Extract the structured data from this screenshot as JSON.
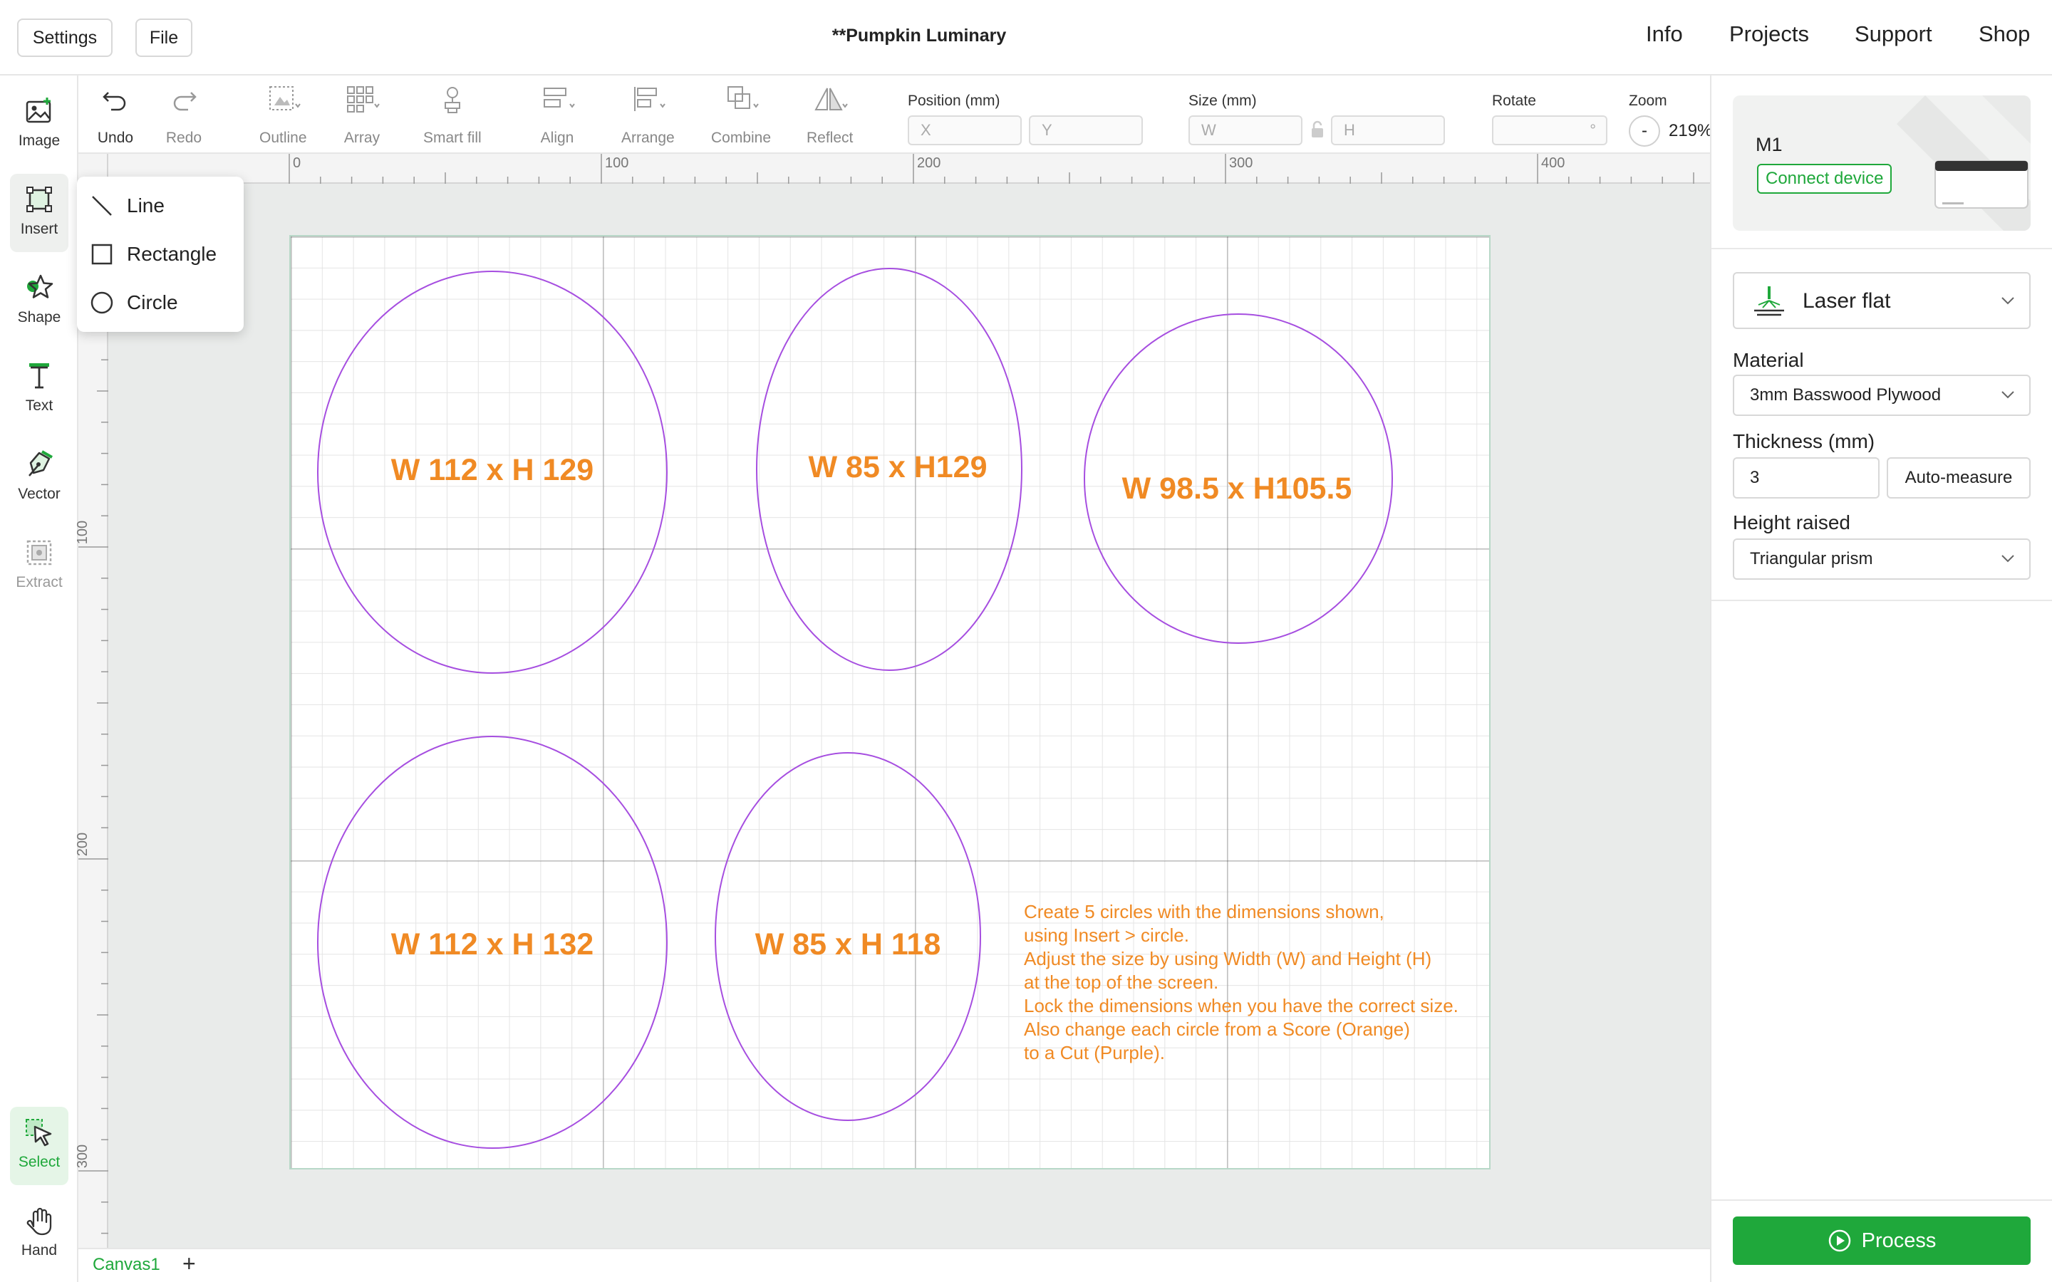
{
  "app": {
    "title": "**Pumpkin Luminary"
  },
  "topbar": {
    "settings_label": "Settings",
    "file_label": "File",
    "nav": [
      "Info",
      "Projects",
      "Support",
      "Shop"
    ]
  },
  "left_tools": [
    {
      "label": "Image",
      "icon": "image-icon"
    },
    {
      "label": "Insert",
      "icon": "insert-icon"
    },
    {
      "label": "Shape",
      "icon": "star-icon"
    },
    {
      "label": "Text",
      "icon": "text-icon"
    },
    {
      "label": "Vector",
      "icon": "pen-icon"
    },
    {
      "label": "Extract",
      "icon": "extract-icon"
    },
    {
      "label": "Select",
      "icon": "cursor-icon"
    },
    {
      "label": "Hand",
      "icon": "hand-icon"
    }
  ],
  "toolbar": {
    "undo": "Undo",
    "redo": "Redo",
    "outline": "Outline",
    "array": "Array",
    "smart_fill": "Smart fill",
    "align": "Align",
    "arrange": "Arrange",
    "combine": "Combine",
    "reflect": "Reflect",
    "position_label": "Position (mm)",
    "x_placeholder": "X",
    "y_placeholder": "Y",
    "size_label": "Size (mm)",
    "w_placeholder": "W",
    "h_placeholder": "H",
    "rotate_label": "Rotate",
    "rotate_unit": "°",
    "zoom_label": "Zoom",
    "zoom_minus": "-",
    "zoom_value": "219%"
  },
  "ruler": {
    "h_ticks": [
      "0",
      "100",
      "200",
      "300",
      "400"
    ],
    "v_ticks": [
      "100",
      "200",
      "300"
    ]
  },
  "insert_menu": {
    "items": [
      "Line",
      "Rectangle",
      "Circle"
    ]
  },
  "canvas": {
    "shape_color": "#a64ee0",
    "label_color": "#f08a24",
    "shapes": [
      {
        "label": "W 112 x H 129"
      },
      {
        "label": "W 85 x H129"
      },
      {
        "label": "W 98.5 x H105.5"
      },
      {
        "label": "W 112 x H 132"
      },
      {
        "label": "W 85 x H 118"
      }
    ],
    "instructions": [
      "Create 5 circles  with the dimensions shown,",
      "using Insert > circle.",
      "Adjust the size by using Width (W) and Height (H)",
      "at the top of the screen.",
      "Lock the dimensions when you have the correct size.",
      "Also change each circle from a Score (Orange)",
      "to a Cut (Purple)."
    ]
  },
  "tabs": {
    "canvas1": "Canvas1",
    "add": "+"
  },
  "right_panel": {
    "device_name": "M1",
    "connect_label": "Connect device",
    "mode": "Laser flat",
    "material_label": "Material",
    "material_value": "3mm Basswood Plywood",
    "thickness_label": "Thickness (mm)",
    "thickness_value": "3",
    "auto_measure": "Auto-measure",
    "height_label": "Height raised",
    "height_value": "Triangular prism",
    "process_label": "Process"
  },
  "colors": {
    "accent": "#1fa83b",
    "score": "#f08a24",
    "cut": "#a64ee0"
  }
}
